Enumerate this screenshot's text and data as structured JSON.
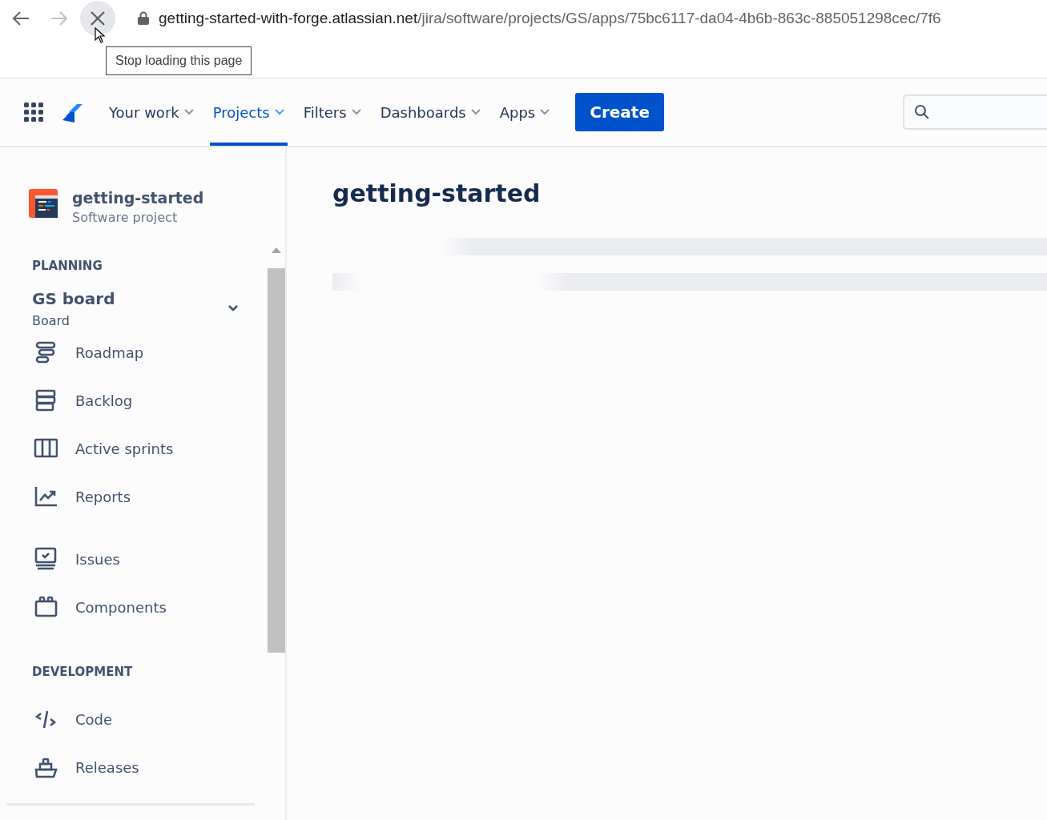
{
  "browser": {
    "url_host": "getting-started-with-forge.atlassian.net",
    "url_path": "/jira/software/projects/GS/apps/75bc6117-da04-4b6b-863c-885051298cec/7f6",
    "tooltip": "Stop loading this page"
  },
  "top_nav": {
    "items": [
      {
        "label": "Your work",
        "selected": false
      },
      {
        "label": "Projects",
        "selected": true
      },
      {
        "label": "Filters",
        "selected": false
      },
      {
        "label": "Dashboards",
        "selected": false
      },
      {
        "label": "Apps",
        "selected": false
      }
    ],
    "create_button": "Create"
  },
  "sidebar": {
    "project": {
      "name": "getting-started",
      "type": "Software project"
    },
    "sections": [
      {
        "heading": "PLANNING",
        "board": {
          "title": "GS board",
          "subtitle": "Board",
          "expanded": true
        },
        "items": [
          {
            "label": "Roadmap",
            "kind": "roadmap"
          },
          {
            "label": "Backlog",
            "kind": "backlog"
          },
          {
            "label": "Active sprints",
            "kind": "sprints"
          },
          {
            "label": "Reports",
            "kind": "reports"
          }
        ]
      },
      {
        "items": [
          {
            "label": "Issues",
            "kind": "issues"
          },
          {
            "label": "Components",
            "kind": "components"
          }
        ]
      },
      {
        "heading": "DEVELOPMENT",
        "items": [
          {
            "label": "Code",
            "kind": "code"
          },
          {
            "label": "Releases",
            "kind": "releases"
          }
        ]
      }
    ]
  },
  "main": {
    "title": "getting-started"
  }
}
